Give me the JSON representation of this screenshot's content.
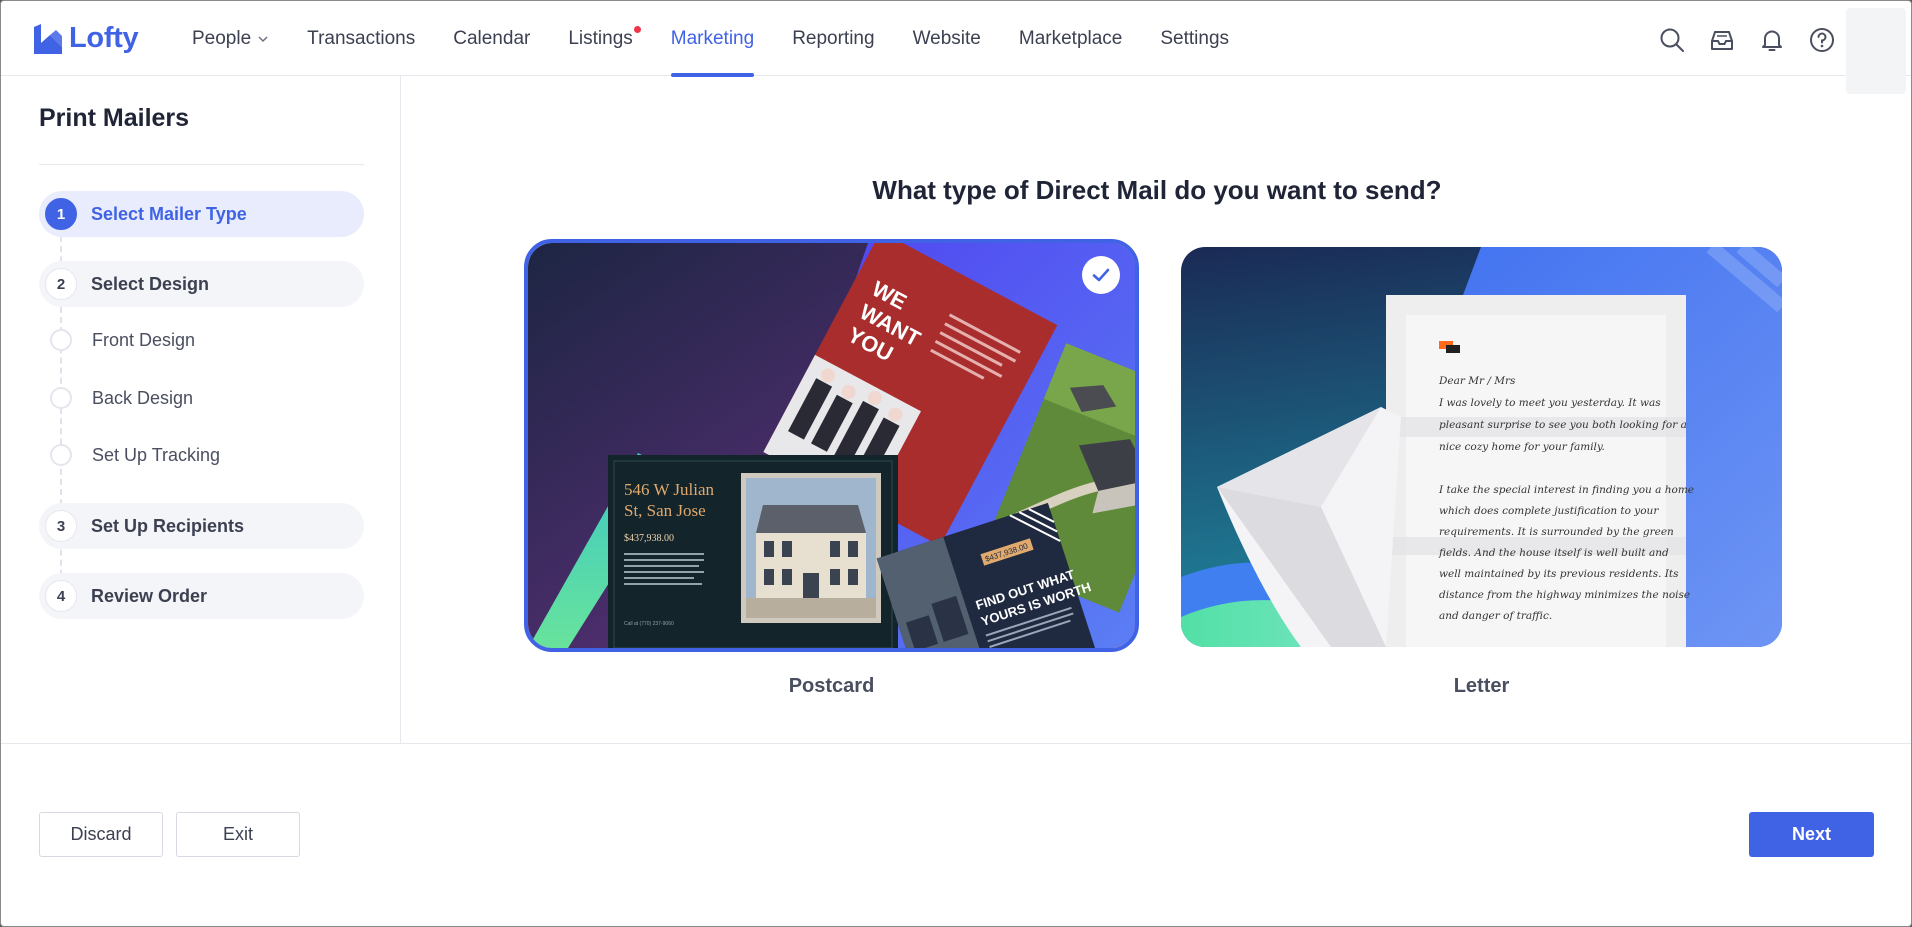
{
  "app": {
    "name": "Lofty",
    "brand_color": "#4063e5"
  },
  "nav": {
    "people": "People",
    "transactions": "Transactions",
    "calendar": "Calendar",
    "listings": "Listings",
    "marketing": "Marketing",
    "reporting": "Reporting",
    "website": "Website",
    "marketplace": "Marketplace",
    "settings": "Settings",
    "active": "Marketing"
  },
  "toolbar_icons": [
    "search-icon",
    "inbox-icon",
    "bell-icon",
    "help-icon"
  ],
  "sidebar": {
    "title": "Print Mailers",
    "steps": [
      {
        "num": "1",
        "label": "Select Mailer Type",
        "active": true
      },
      {
        "num": "2",
        "label": "Select Design"
      },
      {
        "num": "3",
        "label": "Set Up Recipients"
      },
      {
        "num": "4",
        "label": "Review Order"
      }
    ],
    "substeps": [
      "Front Design",
      "Back Design",
      "Set Up Tracking"
    ]
  },
  "main": {
    "question": "What type of Direct Mail do you want to send?",
    "options": [
      {
        "label": "Postcard",
        "selected": true
      },
      {
        "label": "Letter",
        "selected": false
      }
    ],
    "postcard_art": {
      "red_card": [
        "WE",
        "WANT",
        "YOU"
      ],
      "dark_card_address": [
        "546 W Julian",
        "St, San Jose"
      ],
      "dark_card_price": "$437,938.00",
      "dark_card_phone": "Call at (770) 237-9060",
      "navy_card_price": "$437,938.00",
      "navy_card_headline": [
        "FIND OUT WHAT",
        "YOURS IS WORTH"
      ]
    },
    "letter_art": {
      "greeting": "Dear Mr / Mrs",
      "lines": [
        "I was lovely to meet you yesterday. It was",
        "pleasant surprise to see you both looking for a",
        "nice cozy home for your family.",
        "",
        "I take the special interest in finding you a home",
        "which does complete justification to your",
        "requirements. It is surrounded by the green",
        "fields. And the house itself is well built and",
        "well maintained by its previous residents. Its",
        "distance from the highway minimizes the noise",
        "and danger of traffic."
      ]
    }
  },
  "footer": {
    "discard": "Discard",
    "exit": "Exit",
    "next": "Next"
  }
}
